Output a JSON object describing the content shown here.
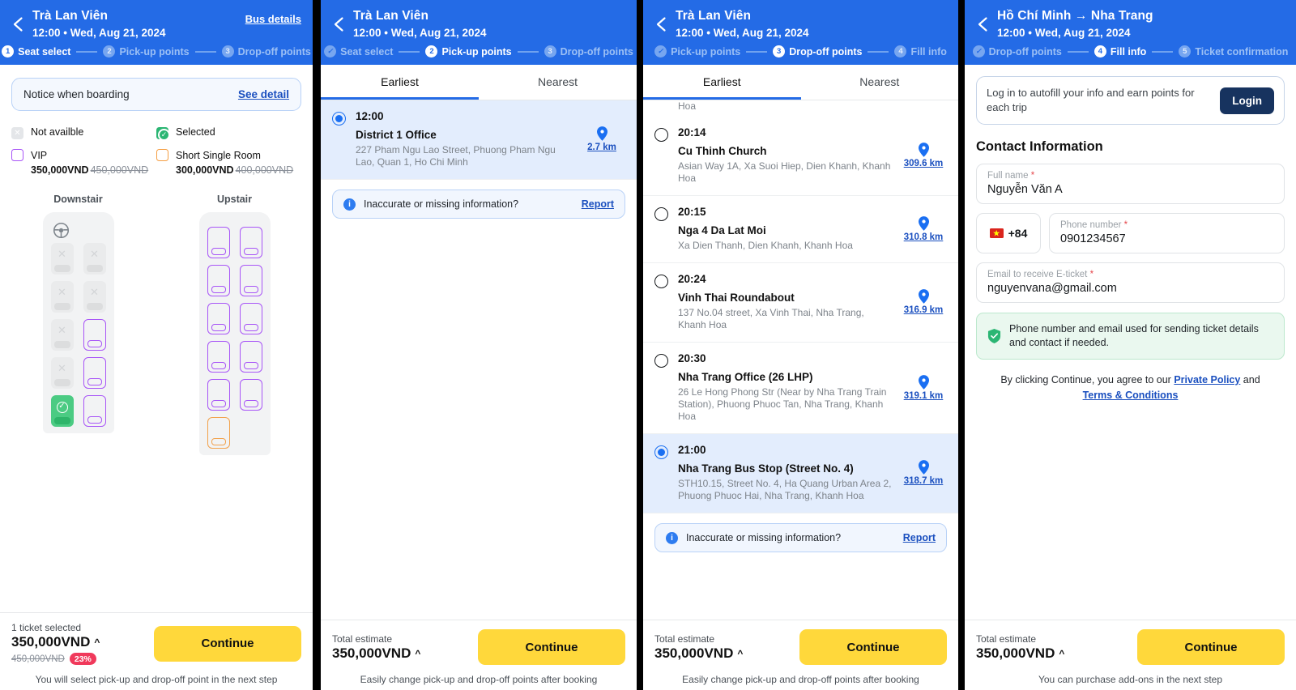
{
  "panels": [
    {
      "header": {
        "title": "Trà Lan Viên",
        "subtitle": "12:00 • Wed, Aug 21, 2024",
        "action_label": "Bus details",
        "back_icon": "back-arrow-icon",
        "steps": [
          {
            "num": "1",
            "label": "Seat select",
            "state": "active"
          },
          {
            "num": "2",
            "label": "Pick-up points",
            "state": "todo"
          },
          {
            "num": "3",
            "label": "Drop-off points",
            "state": "todo"
          }
        ]
      },
      "notice": {
        "label": "Notice when boarding",
        "link": "See detail"
      },
      "legend": [
        {
          "key": "not-available",
          "label": "Not availble"
        },
        {
          "key": "selected",
          "label": "Selected"
        },
        {
          "key": "vip",
          "label": "VIP",
          "price": "350,000VND",
          "old_price": "450,000VND"
        },
        {
          "key": "short-single-room",
          "label": "Short Single Room",
          "price": "300,000VND",
          "old_price": "400,000VND"
        }
      ],
      "decks": [
        {
          "title": "Downstair",
          "has_wheel": true,
          "seats": [
            "na",
            "na",
            "na",
            "na",
            "na",
            "vip",
            "na",
            "vip",
            "sel",
            "vip"
          ]
        },
        {
          "title": "Upstair",
          "has_wheel": false,
          "seats": [
            "vip",
            "vip",
            "vip",
            "vip",
            "vip",
            "vip",
            "vip",
            "vip",
            "vip",
            "vip",
            "ssr",
            "empty"
          ]
        }
      ],
      "footer": {
        "label": "1 ticket selected",
        "price": "350,000VND",
        "caret": "^",
        "old_price": "450,000VND",
        "discount": "23%",
        "button": "Continue",
        "note": "You will select pick-up and drop-off point in the next step"
      }
    },
    {
      "header": {
        "title": "Trà Lan Viên",
        "subtitle": "12:00 • Wed, Aug 21, 2024",
        "back_icon": "back-arrow-icon",
        "steps": [
          {
            "num": "1",
            "label": "Seat select",
            "state": "done"
          },
          {
            "num": "2",
            "label": "Pick-up points",
            "state": "active"
          },
          {
            "num": "3",
            "label": "Drop-off points",
            "state": "todo"
          }
        ]
      },
      "tabs": [
        {
          "label": "Earliest",
          "active": true
        },
        {
          "label": "Nearest",
          "active": false
        }
      ],
      "points": [
        {
          "time": "12:00",
          "name": "District 1 Office",
          "address": "227 Pham Ngu Lao Street, Phuong Pham Ngu Lao, Quan 1, Ho Chi Minh",
          "distance": "2.7 km",
          "selected": true
        }
      ],
      "report": {
        "text": "Inaccurate or missing information?",
        "link": "Report",
        "icon": "info-icon"
      },
      "footer": {
        "label": "Total estimate",
        "price": "350,000VND",
        "caret": "^",
        "button": "Continue",
        "note": "Easily change pick-up and drop-off points after booking"
      }
    },
    {
      "header": {
        "title": "Trà Lan Viên",
        "subtitle": "12:00 • Wed, Aug 21, 2024",
        "back_icon": "back-arrow-icon",
        "steps": [
          {
            "num": "2",
            "label": "Pick-up points",
            "state": "done"
          },
          {
            "num": "3",
            "label": "Drop-off points",
            "state": "active"
          },
          {
            "num": "4",
            "label": "Fill info",
            "state": "todo"
          }
        ]
      },
      "tabs": [
        {
          "label": "Earliest",
          "active": true
        },
        {
          "label": "Nearest",
          "active": false
        }
      ],
      "clipped_top_text": "Hoa",
      "points": [
        {
          "time": "20:14",
          "name": "Cu Thinh Church",
          "address": "Asian Way 1A, Xa Suoi Hiep, Dien Khanh, Khanh Hoa",
          "distance": "309.6 km",
          "selected": false
        },
        {
          "time": "20:15",
          "name": "Nga 4 Da Lat Moi",
          "address": "Xa Dien Thanh, Dien Khanh, Khanh Hoa",
          "distance": "310.8 km",
          "selected": false
        },
        {
          "time": "20:24",
          "name": "Vinh Thai Roundabout",
          "address": "137 No.04 street, Xa Vinh Thai, Nha Trang, Khanh Hoa",
          "distance": "316.9 km",
          "selected": false
        },
        {
          "time": "20:30",
          "name": "Nha Trang Office (26 LHP)",
          "address": "26 Le Hong Phong Str (Near by Nha Trang Train Station), Phuong Phuoc Tan, Nha Trang, Khanh Hoa",
          "distance": "319.1 km",
          "selected": false
        },
        {
          "time": "21:00",
          "name": "Nha Trang Bus Stop (Street No. 4)",
          "address": "STH10.15, Street No. 4, Ha Quang Urban Area 2, Phuong Phuoc Hai, Nha Trang, Khanh Hoa",
          "distance": "318.7 km",
          "selected": true
        }
      ],
      "report": {
        "text": "Inaccurate or missing information?",
        "link": "Report",
        "icon": "info-icon"
      },
      "footer": {
        "label": "Total estimate",
        "price": "350,000VND",
        "caret": "^",
        "button": "Continue",
        "note": "Easily change pick-up and drop-off points after booking"
      }
    },
    {
      "header": {
        "title": "Hồ Chí Minh → Nha Trang",
        "subtitle": "12:00 • Wed, Aug 21, 2024",
        "back_icon": "back-arrow-icon",
        "steps": [
          {
            "num": "3",
            "label": "Drop-off points",
            "state": "done"
          },
          {
            "num": "4",
            "label": "Fill info",
            "state": "active"
          },
          {
            "num": "5",
            "label": "Ticket confirmation",
            "state": "todo"
          }
        ]
      },
      "login": {
        "text": "Log in to autofill your info and earn points for each trip",
        "button": "Login"
      },
      "section_title": "Contact Information",
      "fields": {
        "full_name": {
          "label": "Full name",
          "required": "*",
          "value": "Nguyễn Văn A"
        },
        "country_code": {
          "value": "+84",
          "flag": "vietnam-flag-icon"
        },
        "phone": {
          "label": "Phone number",
          "required": "*",
          "value": "0901234567"
        },
        "email": {
          "label": "Email to receive E-ticket",
          "required": "*",
          "value": "nguyenvana@gmail.com"
        }
      },
      "ok_note": {
        "text": "Phone number and email used for sending ticket details and contact if needed.",
        "icon": "shield-check-icon"
      },
      "terms": {
        "prefix": "By clicking Continue, you agree to our ",
        "link1": "Private Policy",
        "middle": " and ",
        "link2": "Terms & Conditions"
      },
      "footer": {
        "label": "Total estimate",
        "price": "350,000VND",
        "caret": "^",
        "button": "Continue",
        "note": "You can purchase add-ons in the next step"
      }
    }
  ]
}
